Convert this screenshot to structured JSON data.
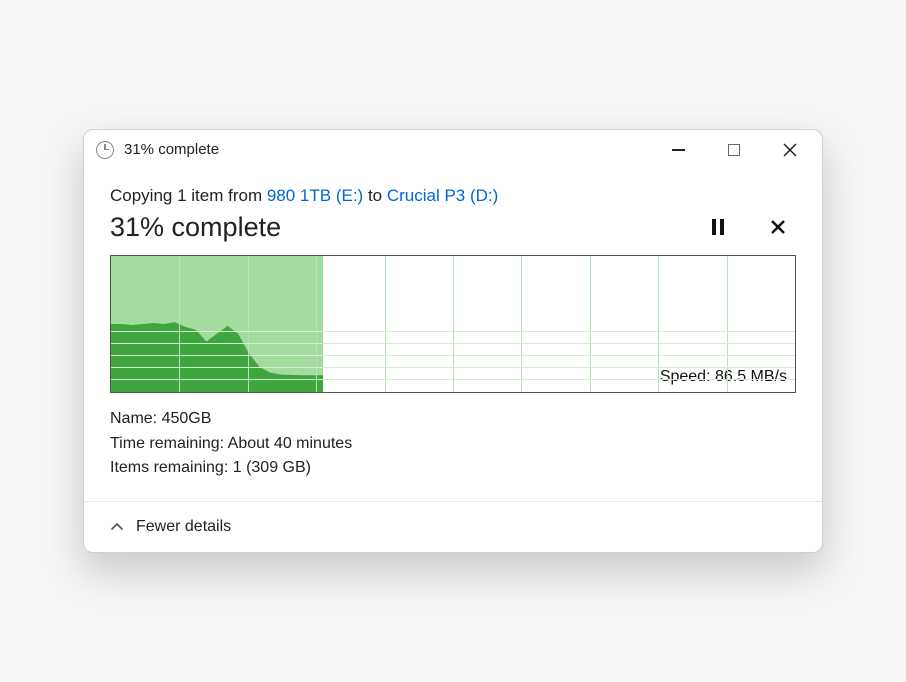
{
  "titlebar": {
    "title": "31% complete"
  },
  "copyline": {
    "prefix": "Copying 1 item from ",
    "source": "980 1TB (E:)",
    "middle": " to ",
    "destination": "Crucial P3 (D:)"
  },
  "progress": {
    "text": "31% complete",
    "percent": 31
  },
  "speed": {
    "label": "Speed: ",
    "value": "86.5 MB/s"
  },
  "details": {
    "name_label": "Name: ",
    "name_value": "450GB",
    "time_label": "Time remaining:  ",
    "time_value": "About 40 minutes",
    "items_label": "Items remaining:  ",
    "items_value": "1 (309 GB)"
  },
  "footer": {
    "toggle": "Fewer details"
  },
  "chart_data": {
    "type": "area",
    "title": "Transfer speed over time",
    "xlabel": "",
    "ylabel": "Speed",
    "ylim": [
      0,
      700
    ],
    "progress_pct": 31,
    "current_speed_mb_s": 86.5,
    "series": [
      {
        "name": "Speed (MB/s)",
        "values": [
          350,
          350,
          345,
          350,
          355,
          350,
          360,
          335,
          320,
          260,
          300,
          340,
          300,
          200,
          130,
          100,
          90,
          88,
          86,
          86,
          86
        ]
      }
    ],
    "x": [
      0,
      1,
      2,
      3,
      4,
      5,
      6,
      7,
      8,
      9,
      10,
      11,
      12,
      13,
      14,
      15,
      16,
      17,
      18,
      19,
      20
    ]
  }
}
